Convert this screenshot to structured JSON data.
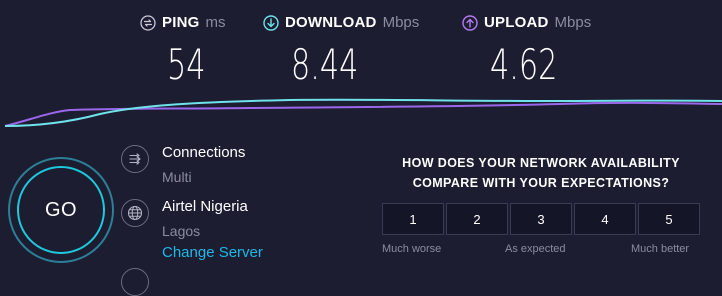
{
  "metrics": {
    "ping": {
      "label": "PING",
      "unit": "ms",
      "value": "54",
      "icon": "ping-icon",
      "color": "#c9cad6"
    },
    "download": {
      "label": "DOWNLOAD",
      "unit": "Mbps",
      "value": "8.44",
      "icon": "download-arrow-icon",
      "color": "#6fe2ea"
    },
    "upload": {
      "label": "UPLOAD",
      "unit": "Mbps",
      "value": "4.62",
      "icon": "upload-arrow-icon",
      "color": "#b57cf0"
    }
  },
  "graph_colors": {
    "download": "#6fe2ea",
    "upload": "#9a67ea"
  },
  "go": {
    "label": "GO"
  },
  "connections": {
    "title": "Connections",
    "mode": "Multi",
    "icon": "connections-icon"
  },
  "server": {
    "provider": "Airtel Nigeria",
    "location": "Lagos",
    "change_label": "Change Server",
    "icon": "globe-icon"
  },
  "survey": {
    "question": "HOW DOES YOUR NETWORK AVAILABILITY COMPARE WITH YOUR EXPECTATIONS?",
    "options": [
      "1",
      "2",
      "3",
      "4",
      "5"
    ],
    "scale_low": "Much worse",
    "scale_mid": "As expected",
    "scale_high": "Much better"
  },
  "accent": "#1fc8dc",
  "link_color": "#1fb8e6"
}
